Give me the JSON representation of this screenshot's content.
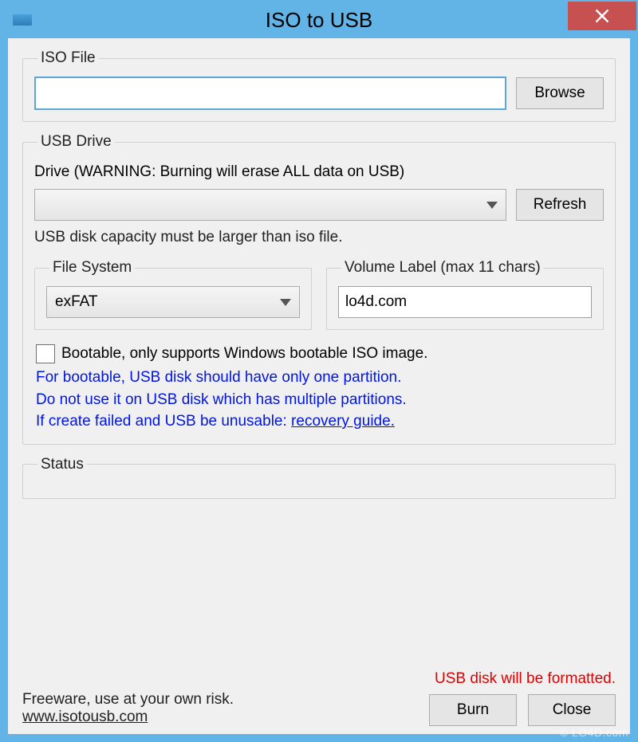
{
  "window": {
    "title": "ISO to USB"
  },
  "iso": {
    "legend": "ISO File",
    "path": "",
    "browse": "Browse"
  },
  "usb": {
    "legend": "USB Drive",
    "drive_label": "Drive (WARNING: Burning will erase ALL data on USB)",
    "drive_value": "",
    "refresh": "Refresh",
    "capacity_note": "USB disk capacity must be larger than iso file.",
    "fs": {
      "legend": "File System",
      "value": "exFAT"
    },
    "vol": {
      "legend": "Volume Label (max 11 chars)",
      "value": "lo4d.com"
    },
    "bootable_label": "Bootable, only supports Windows bootable ISO image.",
    "bootable_checked": false,
    "tip1": "For bootable, USB disk should have only one partition.",
    "tip2": "Do not use it on USB disk which has multiple partitions.",
    "tip3_prefix": "If create failed and USB be unusable: ",
    "tip3_link": "recovery guide."
  },
  "status": {
    "legend": "Status"
  },
  "footer": {
    "freeware": "Freeware, use at your own risk.",
    "site": "www.isotousb.com",
    "format_warning": "USB disk will be formatted.",
    "burn": "Burn",
    "close": "Close"
  },
  "watermark": "© LO4D.com"
}
